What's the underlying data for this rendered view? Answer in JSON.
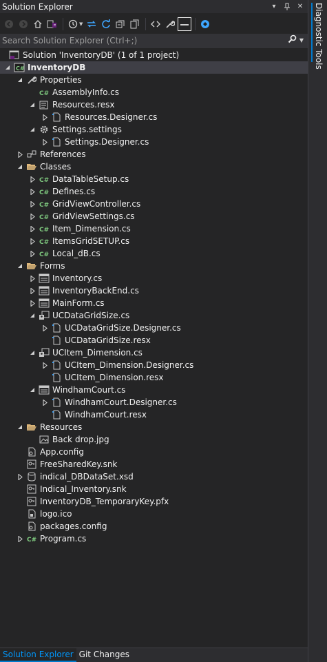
{
  "title": "Solution Explorer",
  "side_tab": "Diagnostic Tools",
  "search": {
    "placeholder": "Search Solution Explorer (Ctrl+;)"
  },
  "bottom_tabs": [
    "Solution Explorer",
    "Git Changes"
  ],
  "tree": [
    {
      "label": "Solution 'InventoryDB' (1 of 1 project)",
      "icon": "solution-icon",
      "level": 0,
      "expander": "none",
      "bold": false
    },
    {
      "label": "InventoryDB",
      "icon": "csharp-project-icon",
      "level": 0,
      "expander": "expanded",
      "bold": true,
      "selected": true
    },
    {
      "label": "Properties",
      "icon": "wrench-icon",
      "level": 1,
      "expander": "expanded"
    },
    {
      "label": "AssemblyInfo.cs",
      "icon": "csharp-file-icon",
      "level": 2,
      "expander": "none"
    },
    {
      "label": "Resources.resx",
      "icon": "resx-icon",
      "level": 2,
      "expander": "expanded"
    },
    {
      "label": "Resources.Designer.cs",
      "icon": "designer-file-icon",
      "level": 3,
      "expander": "collapsed"
    },
    {
      "label": "Settings.settings",
      "icon": "settings-gear-icon",
      "level": 2,
      "expander": "expanded"
    },
    {
      "label": "Settings.Designer.cs",
      "icon": "designer-file-icon",
      "level": 3,
      "expander": "collapsed"
    },
    {
      "label": "References",
      "icon": "references-icon",
      "level": 1,
      "expander": "collapsed"
    },
    {
      "label": "Classes",
      "icon": "folder-open-icon",
      "level": 1,
      "expander": "expanded"
    },
    {
      "label": "DataTableSetup.cs",
      "icon": "csharp-file-icon",
      "level": 2,
      "expander": "collapsed"
    },
    {
      "label": "Defines.cs",
      "icon": "csharp-file-icon",
      "level": 2,
      "expander": "collapsed"
    },
    {
      "label": "GridViewController.cs",
      "icon": "csharp-file-icon",
      "level": 2,
      "expander": "collapsed"
    },
    {
      "label": "GridViewSettings.cs",
      "icon": "csharp-file-icon",
      "level": 2,
      "expander": "collapsed"
    },
    {
      "label": "Item_Dimension.cs",
      "icon": "csharp-file-icon",
      "level": 2,
      "expander": "collapsed"
    },
    {
      "label": "ItemsGridSETUP.cs",
      "icon": "csharp-file-icon",
      "level": 2,
      "expander": "collapsed"
    },
    {
      "label": "Local_dB.cs",
      "icon": "csharp-file-icon",
      "level": 2,
      "expander": "collapsed"
    },
    {
      "label": "Forms",
      "icon": "folder-open-icon",
      "level": 1,
      "expander": "expanded"
    },
    {
      "label": "Inventory.cs",
      "icon": "form-icon",
      "level": 2,
      "expander": "collapsed"
    },
    {
      "label": "InventoryBackEnd.cs",
      "icon": "form-icon",
      "level": 2,
      "expander": "collapsed"
    },
    {
      "label": "MainForm.cs",
      "icon": "form-icon",
      "level": 2,
      "expander": "collapsed"
    },
    {
      "label": "UCDataGridSize.cs",
      "icon": "user-control-icon",
      "level": 2,
      "expander": "expanded"
    },
    {
      "label": "UCDataGridSize.Designer.cs",
      "icon": "designer-file-icon",
      "level": 3,
      "expander": "collapsed"
    },
    {
      "label": "UCDataGridSize.resx",
      "icon": "designer-file-icon",
      "level": 3,
      "expander": "none"
    },
    {
      "label": "UCItem_Dimension.cs",
      "icon": "user-control-icon",
      "level": 2,
      "expander": "expanded"
    },
    {
      "label": "UCItem_Dimension.Designer.cs",
      "icon": "designer-file-icon",
      "level": 3,
      "expander": "collapsed"
    },
    {
      "label": "UCItem_Dimension.resx",
      "icon": "designer-file-icon",
      "level": 3,
      "expander": "none"
    },
    {
      "label": "WindhamCourt.cs",
      "icon": "form-icon",
      "level": 2,
      "expander": "expanded"
    },
    {
      "label": "WindhamCourt.Designer.cs",
      "icon": "designer-file-icon",
      "level": 3,
      "expander": "collapsed"
    },
    {
      "label": "WindhamCourt.resx",
      "icon": "designer-file-icon",
      "level": 3,
      "expander": "none"
    },
    {
      "label": "Resources",
      "icon": "folder-open-icon",
      "level": 1,
      "expander": "expanded"
    },
    {
      "label": "Back drop.jpg",
      "icon": "image-file-icon",
      "level": 2,
      "expander": "none"
    },
    {
      "label": "App.config",
      "icon": "config-file-icon",
      "level": 1,
      "expander": "none"
    },
    {
      "label": "FreeSharedKey.snk",
      "icon": "key-file-icon",
      "level": 1,
      "expander": "none"
    },
    {
      "label": "indical_DBDataSet.xsd",
      "icon": "dataset-icon",
      "level": 1,
      "expander": "collapsed"
    },
    {
      "label": "Indical_Inventory.snk",
      "icon": "key-file-icon",
      "level": 1,
      "expander": "none"
    },
    {
      "label": "InventoryDB_TemporaryKey.pfx",
      "icon": "key-file-icon",
      "level": 1,
      "expander": "none"
    },
    {
      "label": "logo.ico",
      "icon": "ico-file-icon",
      "level": 1,
      "expander": "none"
    },
    {
      "label": "packages.config",
      "icon": "config-file-icon",
      "level": 1,
      "expander": "none"
    },
    {
      "label": "Program.cs",
      "icon": "csharp-file-icon",
      "level": 1,
      "expander": "collapsed"
    }
  ],
  "colors": {
    "background": "#252526",
    "selection": "#3f3f46",
    "accent": "#007acc",
    "csharp_green": "#7fc97f",
    "folder": "#dcb67a"
  }
}
